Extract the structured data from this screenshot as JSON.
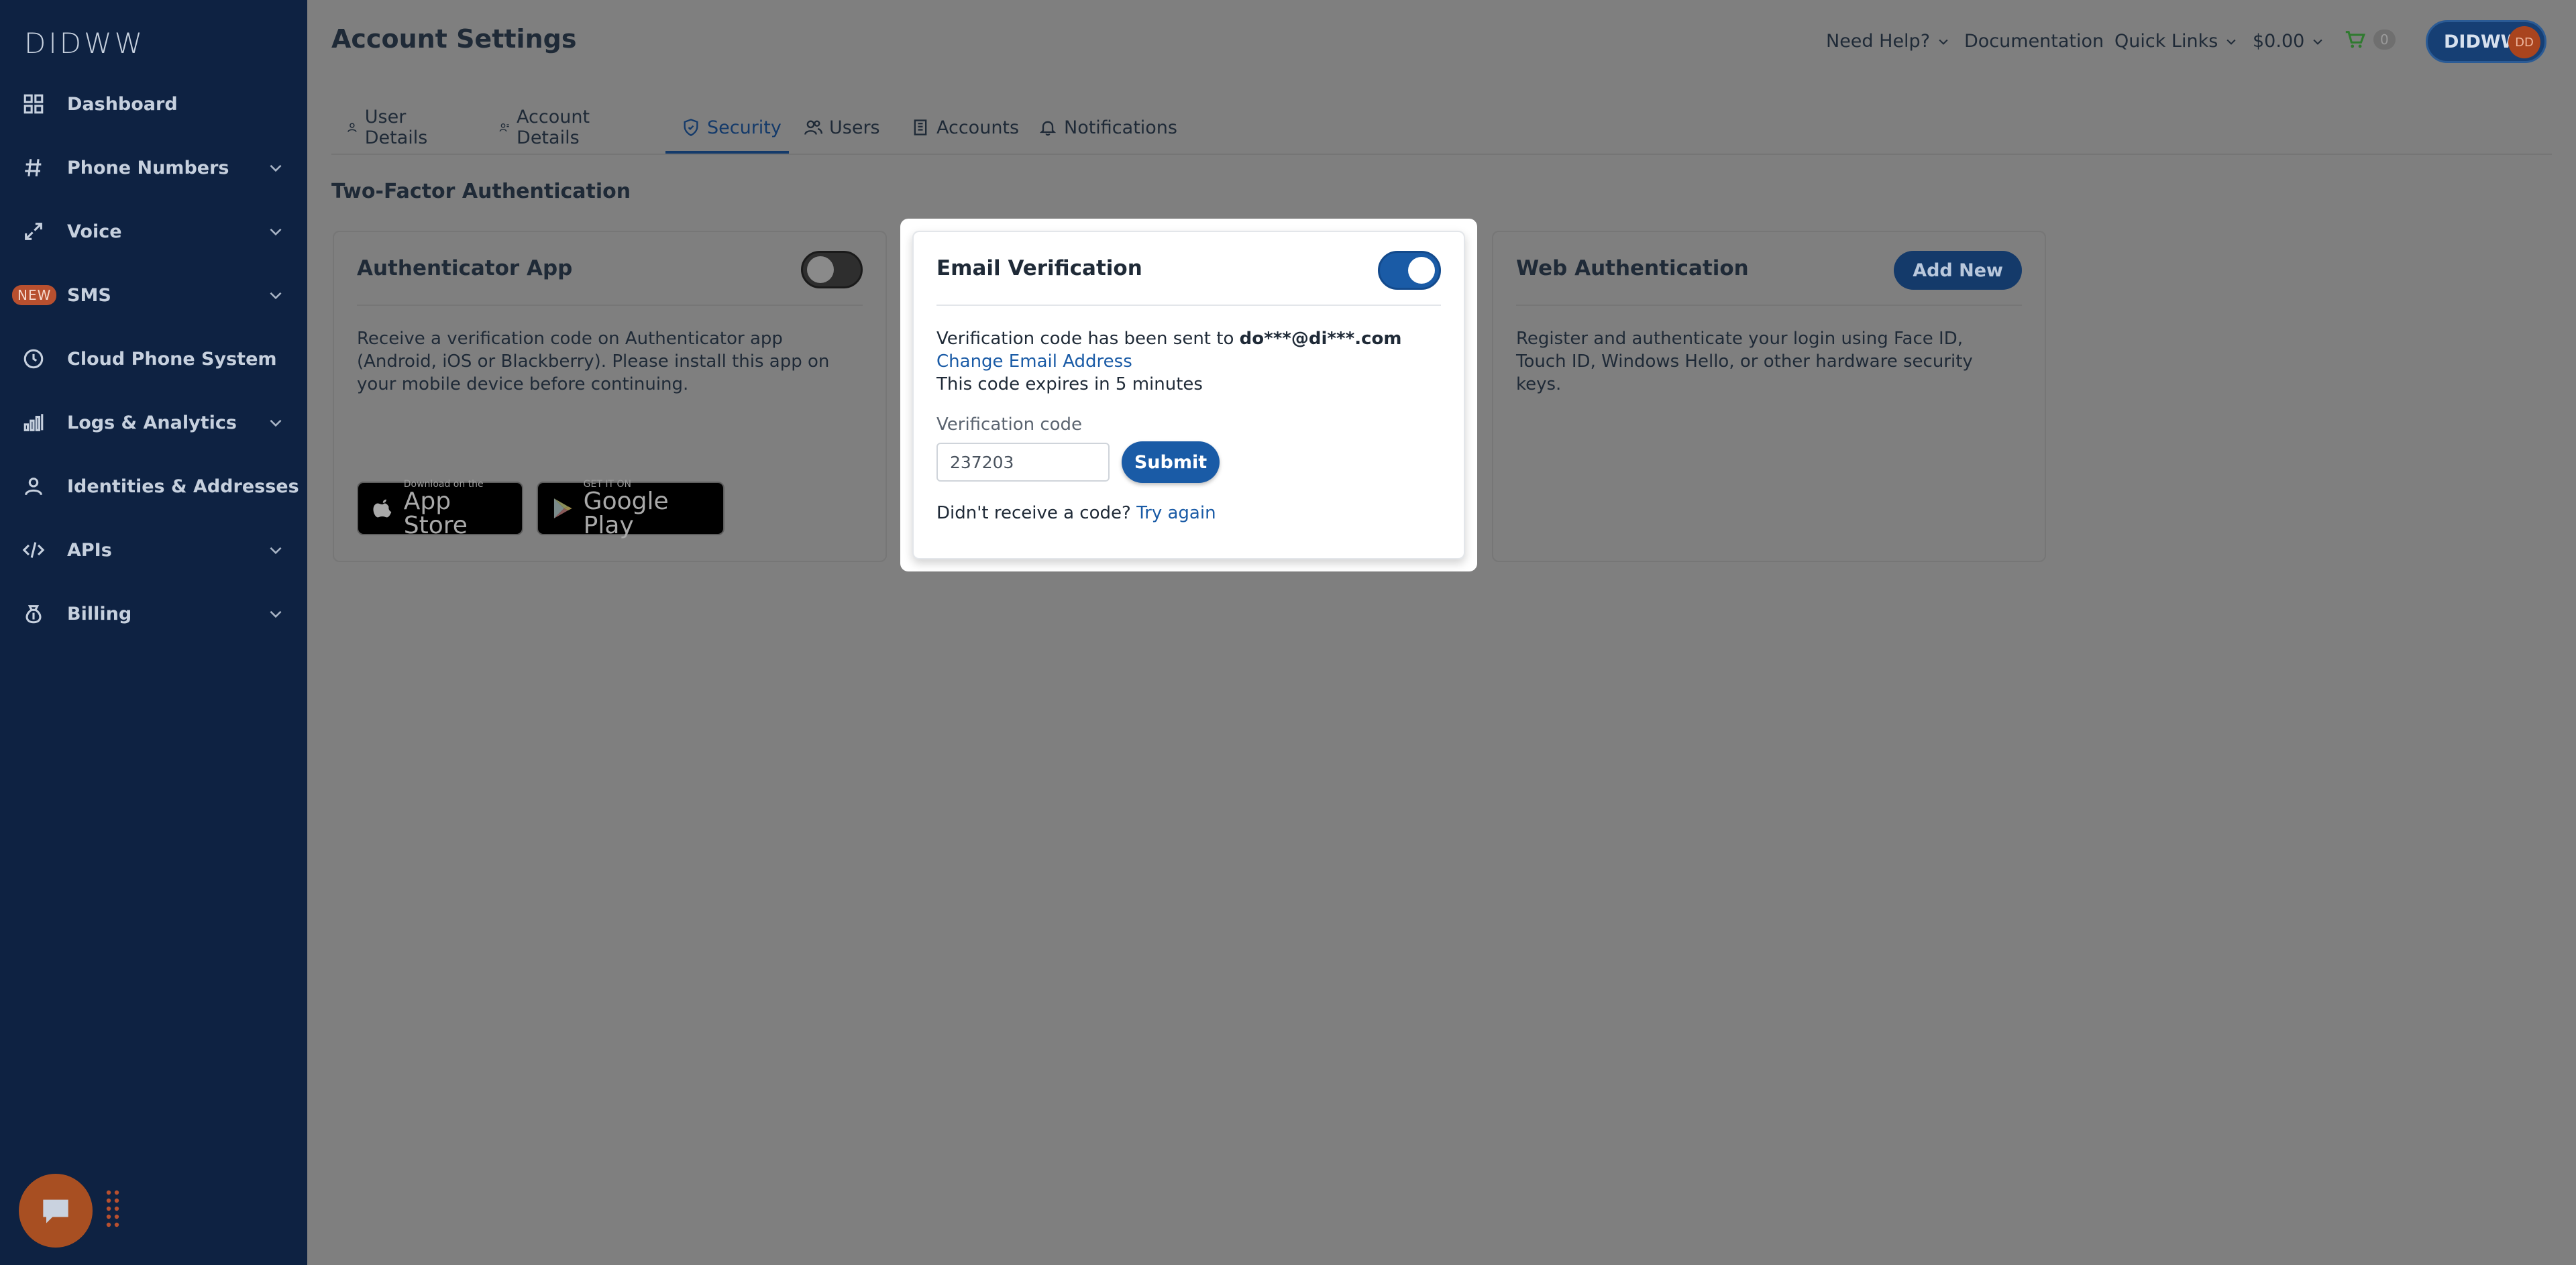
{
  "app": {
    "logo": "DIDWW"
  },
  "sidebar": {
    "items": [
      {
        "label": "Dashboard",
        "icon": "grid-icon",
        "chevron": false
      },
      {
        "label": "Phone Numbers",
        "icon": "hash-icon",
        "chevron": true
      },
      {
        "label": "Voice",
        "icon": "phone-arrows-icon",
        "chevron": true
      },
      {
        "label": "SMS",
        "icon": "none",
        "chevron": true,
        "badge": "NEW"
      },
      {
        "label": "Cloud Phone System",
        "icon": "cloud-clock-icon",
        "chevron": false
      },
      {
        "label": "Logs & Analytics",
        "icon": "bar-chart-icon",
        "chevron": true
      },
      {
        "label": "Identities & Addresses",
        "icon": "user-icon",
        "chevron": false
      },
      {
        "label": "APIs",
        "icon": "code-icon",
        "chevron": true
      },
      {
        "label": "Billing",
        "icon": "money-bag-icon",
        "chevron": true
      }
    ]
  },
  "header": {
    "title": "Account Settings",
    "need_help": "Need Help?",
    "documentation": "Documentation",
    "quick_links": "Quick Links",
    "balance": "$0.00",
    "cart_count": "0",
    "user_label": "DIDWW",
    "avatar_initials": "DD"
  },
  "tabs": [
    {
      "label": "User Details",
      "icon": "user-icon"
    },
    {
      "label": "Account Details",
      "icon": "user-lines-icon"
    },
    {
      "label": "Security",
      "icon": "shield-icon",
      "active": true
    },
    {
      "label": "Users",
      "icon": "users-icon"
    },
    {
      "label": "Accounts",
      "icon": "building-icon"
    },
    {
      "label": "Notifications",
      "icon": "bell-icon"
    }
  ],
  "section_title": "Two-Factor Authentication",
  "authenticator": {
    "title": "Authenticator App",
    "description": "Receive a verification code on Authenticator app (Android, iOS or Blackberry). Please install this app on your mobile device before continuing.",
    "toggle_on": false,
    "app_store_small": "Download on the",
    "app_store_big": "App Store",
    "google_play_small": "GET IT ON",
    "google_play_big": "Google Play"
  },
  "email_verification": {
    "title": "Email Verification",
    "toggle_on": true,
    "sent_prefix": "Verification code has been sent to ",
    "masked_email": "do***@di***.com",
    "change_email": "Change Email Address",
    "expires": "This code expires in 5 minutes",
    "code_label": "Verification code",
    "code_value": "237203",
    "submit_label": "Submit",
    "didnt_receive": "Didn't receive a code? ",
    "try_again": "Try again"
  },
  "web_auth": {
    "title": "Web Authentication",
    "add_new": "Add New",
    "description": "Register and authenticate your login using Face ID, Touch ID, Windows Hello, or other hardware security keys."
  },
  "colors": {
    "sidebar_bg": "#0e2242",
    "overlay_bg": "#7f7f7f",
    "primary": "#1a5ba6",
    "accent_orange": "#a84f22"
  }
}
